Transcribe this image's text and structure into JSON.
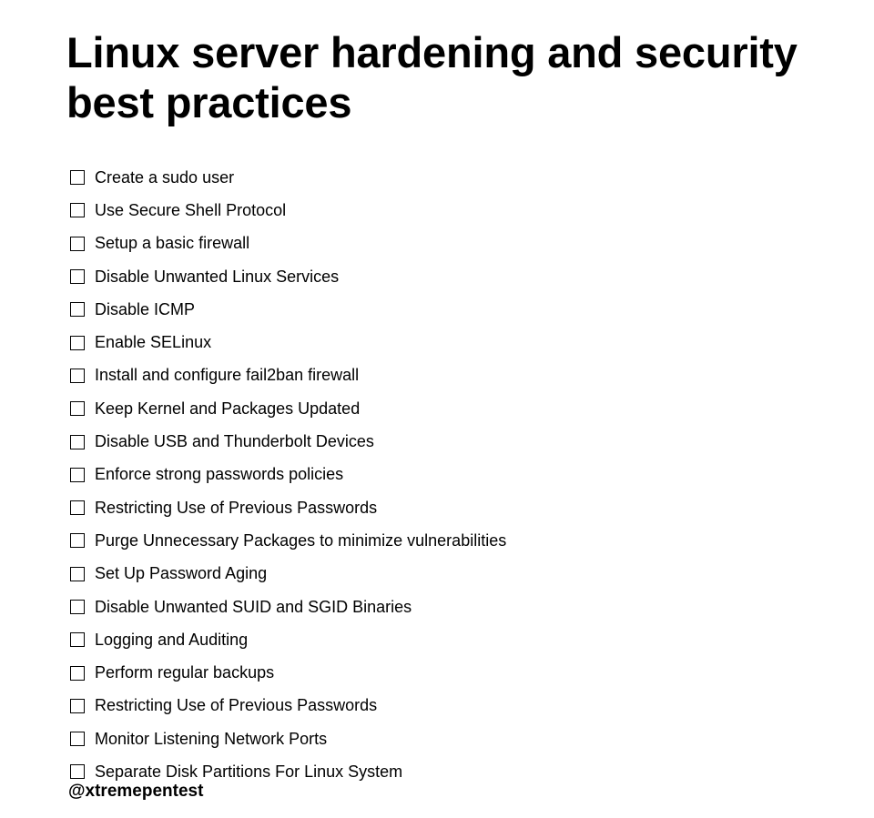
{
  "title": "Linux server hardening and security best practices",
  "checklist": [
    {
      "label": "Create a sudo user",
      "checked": false
    },
    {
      "label": "Use Secure Shell Protocol",
      "checked": false
    },
    {
      "label": "Setup a basic firewall",
      "checked": false
    },
    {
      "label": "Disable Unwanted Linux Services",
      "checked": false
    },
    {
      "label": "Disable ICMP",
      "checked": false
    },
    {
      "label": "Enable SELinux",
      "checked": false
    },
    {
      "label": "Install and configure fail2ban firewall",
      "checked": false
    },
    {
      "label": "Keep Kernel and Packages Updated",
      "checked": false
    },
    {
      "label": "Disable USB and Thunderbolt Devices",
      "checked": false
    },
    {
      "label": "Enforce strong passwords policies",
      "checked": false
    },
    {
      "label": "Restricting Use of Previous Passwords",
      "checked": false
    },
    {
      "label": "Purge Unnecessary Packages to minimize vulnerabilities",
      "checked": false
    },
    {
      "label": "Set Up Password Aging",
      "checked": false
    },
    {
      "label": "Disable Unwanted SUID and SGID Binaries",
      "checked": false
    },
    {
      "label": "Logging and Auditing",
      "checked": false
    },
    {
      "label": "Perform regular backups",
      "checked": false
    },
    {
      "label": "Restricting Use of Previous Passwords",
      "checked": false
    },
    {
      "label": "Monitor Listening Network Ports",
      "checked": false
    },
    {
      "label": "Separate Disk Partitions For Linux System",
      "checked": false
    }
  ],
  "footer": {
    "handle": "@xtremepentest"
  }
}
